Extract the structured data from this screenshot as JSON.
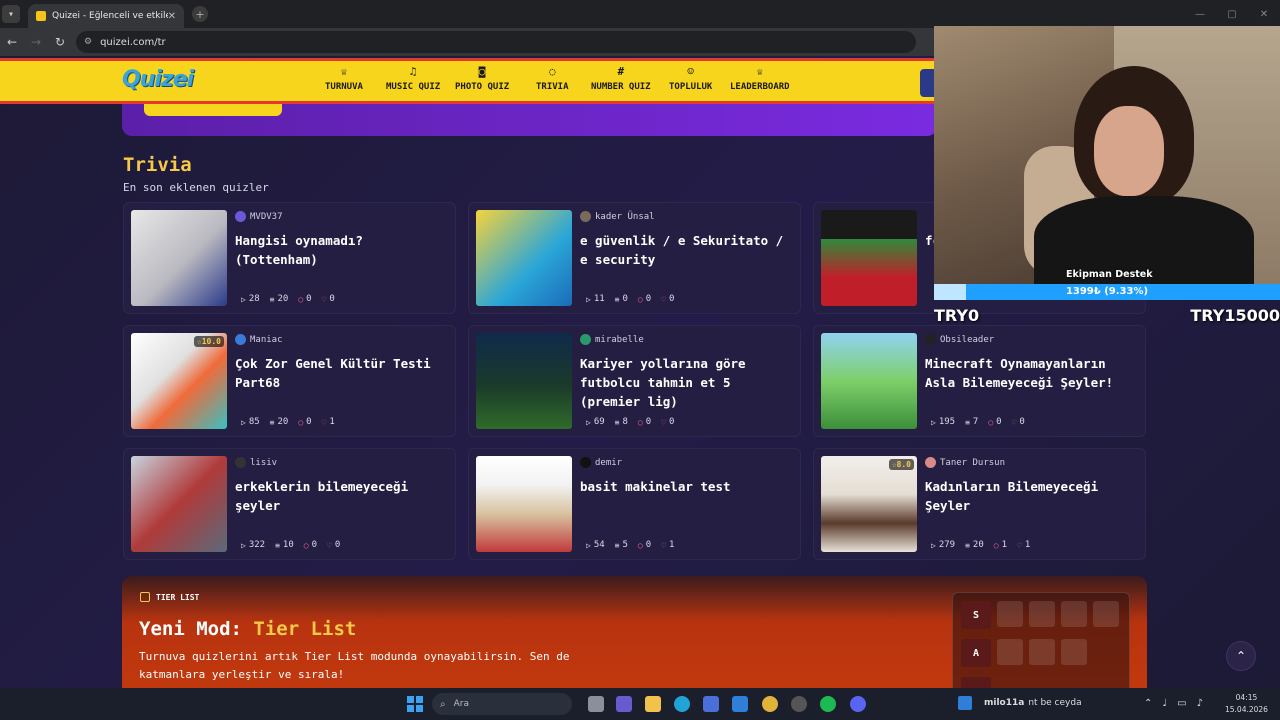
{
  "browser": {
    "tab_title": "Quizei - Eğlenceli ve etkileşimli",
    "url": "quizei.com/tr"
  },
  "site": {
    "logo": "Quizei",
    "nav": [
      {
        "icon": "trophy-icon",
        "glyph": "♕",
        "label": "TURNUVA"
      },
      {
        "icon": "music-icon",
        "glyph": "♫",
        "label": "MUSIC QUIZ"
      },
      {
        "icon": "camera-icon",
        "glyph": "◙",
        "label": "PHOTO QUIZ"
      },
      {
        "icon": "chat-icon",
        "glyph": "◌",
        "label": "TRIVIA"
      },
      {
        "icon": "hash-icon",
        "glyph": "#",
        "label": "NUMBER QUIZ"
      },
      {
        "icon": "users-icon",
        "glyph": "☺",
        "label": "TOPLULUK"
      },
      {
        "icon": "medal-icon",
        "glyph": "♕",
        "label": "LEADERBOARD"
      }
    ]
  },
  "trivia": {
    "title": "Trivia",
    "subtitle": "En son eklenen quizler",
    "cards": [
      {
        "author": "MVDV37",
        "title": "Hangisi oynamadı? (Tottenham)",
        "plays": "28",
        "questions": "20",
        "comments": "0",
        "likes": "0",
        "rating": ""
      },
      {
        "author": "kader Ünsal",
        "title": "e güvenlik / e Sekuritato / e security",
        "plays": "11",
        "questions": "0",
        "comments": "0",
        "likes": "0",
        "rating": ""
      },
      {
        "author": "",
        "title": "fc",
        "plays": "",
        "questions": "",
        "comments": "",
        "likes": "",
        "rating": ""
      },
      {
        "author": "Maniac",
        "title": "Çok Zor Genel Kültür Testi Part68",
        "plays": "85",
        "questions": "20",
        "comments": "0",
        "likes": "1",
        "rating": "10.0"
      },
      {
        "author": "mirabelle",
        "title": "Kariyer yollarına göre futbolcu tahmin et 5 (premier lig)",
        "plays": "69",
        "questions": "8",
        "comments": "0",
        "likes": "0",
        "rating": ""
      },
      {
        "author": "Obsileader",
        "title": "Minecraft Oynamayanların Asla Bilemeyeceği Şeyler!",
        "plays": "195",
        "questions": "7",
        "comments": "0",
        "likes": "0",
        "rating": ""
      },
      {
        "author": "lisiv",
        "title": "erkeklerin bilemeyeceği şeyler",
        "plays": "322",
        "questions": "10",
        "comments": "0",
        "likes": "0",
        "rating": ""
      },
      {
        "author": "demir",
        "title": "basit makinelar test",
        "plays": "54",
        "questions": "5",
        "comments": "0",
        "likes": "1",
        "rating": ""
      },
      {
        "author": "Taner Dursun",
        "title": "Kadınların Bilemeyeceği Şeyler",
        "plays": "279",
        "questions": "20",
        "comments": "1",
        "likes": "1",
        "rating": "8.0"
      }
    ]
  },
  "tier": {
    "badge": "TIER LIST",
    "title_prefix": "Yeni Mod: ",
    "title_highlight": "Tier List",
    "description": "Turnuva quizlerini artık Tier List modunda oynayabilirsin. Sen de katmanlara yerleştir ve sırala!",
    "rows": [
      "S",
      "A",
      ""
    ]
  },
  "overlay": {
    "label": "Ekipman Destek",
    "progress_text": "1399₺ (9.33%)",
    "progress_fraction": 0.0933,
    "min": "TRY0",
    "max": "TRY15000"
  },
  "taskbar": {
    "search_placeholder": "Ara",
    "notif_user": "milo11a",
    "notif_text": "nt be ceyda",
    "time": "04:15",
    "date": "15.04.2026"
  },
  "colors": {
    "accent": "#f7d51d",
    "header_border": "#e23b2e",
    "title": "#f7c948",
    "bg": "#1e1a3a"
  }
}
